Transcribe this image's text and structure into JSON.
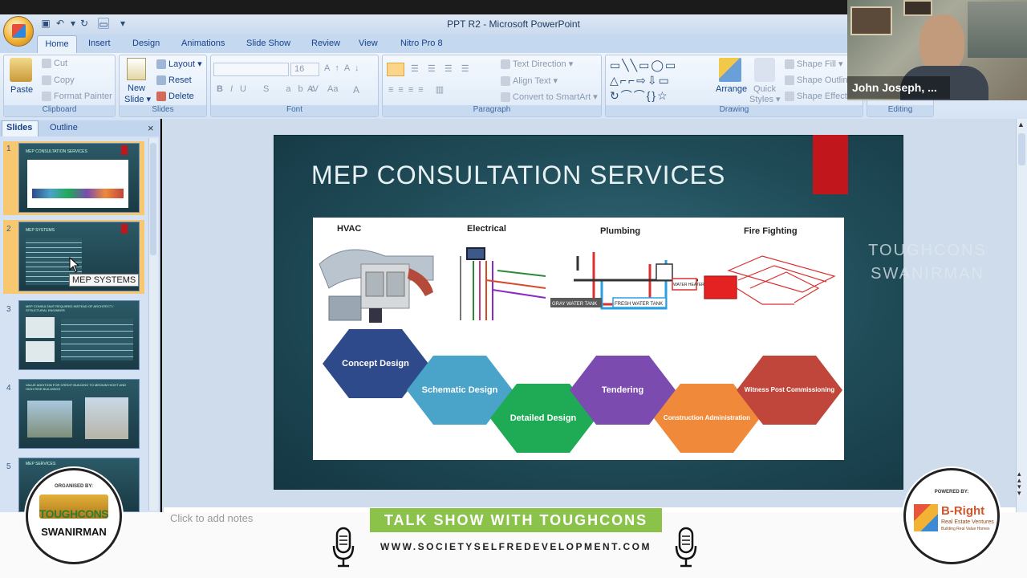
{
  "app": {
    "title": "PPT R2 - Microsoft PowerPoint"
  },
  "ribbon": {
    "tabs": [
      "Home",
      "Insert",
      "Design",
      "Animations",
      "Slide Show",
      "Review",
      "View",
      "Nitro Pro 8"
    ],
    "groups": {
      "clipboard": {
        "label": "Clipboard",
        "paste": "Paste",
        "cut": "Cut",
        "copy": "Copy",
        "format_painter": "Format Painter"
      },
      "slides": {
        "label": "Slides",
        "new_slide": "New",
        "new_slide2": "Slide ▾",
        "layout": "Layout ▾",
        "reset": "Reset",
        "delete": "Delete"
      },
      "font": {
        "label": "Font",
        "size": "16"
      },
      "paragraph": {
        "label": "Paragraph",
        "text_direction": "Text Direction ▾",
        "align_text": "Align Text ▾",
        "convert_smartart": "Convert to SmartArt ▾"
      },
      "drawing": {
        "label": "Drawing",
        "arrange": "Arrange",
        "quick_styles": "Quick",
        "quick_styles2": "Styles ▾",
        "shape_fill": "Shape Fill ▾",
        "shape_outline": "Shape Outline",
        "shape_effects": "Shape Effects"
      },
      "editing": {
        "label": "Editing"
      }
    }
  },
  "left_pane": {
    "tabs": [
      "Slides",
      "Outline"
    ],
    "close": "×",
    "thumbnails": [
      {
        "num": "1",
        "title": "MEP CONSULTATION SERVICES"
      },
      {
        "num": "2",
        "title": "MEP SYSTEMS"
      },
      {
        "num": "3",
        "title": "MEP CONSULTANT REQUIRED INSTEAD OF ARCHITECT / STRUCTURAL ENGINEER"
      },
      {
        "num": "4",
        "title": "VALUE ADDITION FOR CREDIT BUILDING TO MEDIUM HIGHT AND HIGH RISE BUILDINGS"
      },
      {
        "num": "5",
        "title": "MEP SERVICES"
      }
    ],
    "tooltip": "MEP SYSTEMS"
  },
  "slide": {
    "title": "MEP CONSULTATION SERVICES",
    "categories": [
      "HVAC",
      "Electrical",
      "Plumbing",
      "Fire Fighting"
    ],
    "plumbing_labels": [
      "GRAY WATER TANK",
      "FRESH WATER TANK",
      "WATER HEATER"
    ],
    "stages": [
      {
        "label": "Concept Design",
        "color": "#2e4a8a"
      },
      {
        "label": "Schematic Design",
        "color": "#4aa3c8"
      },
      {
        "label": "Detailed Design",
        "color": "#1faa55"
      },
      {
        "label": "Tendering",
        "color": "#7b4bb0"
      },
      {
        "label": "Construction Administration",
        "color": "#f08a3a"
      },
      {
        "label": "Witness Post Commissioning",
        "color": "#c0463b"
      }
    ]
  },
  "notes": {
    "placeholder": "Click to add notes"
  },
  "video": {
    "participant": "John Joseph, ..."
  },
  "watermark": {
    "line1": "TOUGHCONS",
    "line2": "SWANIRMAN"
  },
  "overlay": {
    "banner": "TALK SHOW WITH TOUGHCONS",
    "website": "WWW.SOCIETYSELFREDEVELOPMENT.COM",
    "organised_by": "ORGANISED BY:",
    "org_logo1": "TOUGHCONS",
    "org_logo2": "SWANIRMAN",
    "powered_by": "POWERED BY:",
    "sponsor_logo1": "B-Right",
    "sponsor_logo2": "Real Estate Ventures",
    "sponsor_logo3": "Building Real Value Homes"
  }
}
